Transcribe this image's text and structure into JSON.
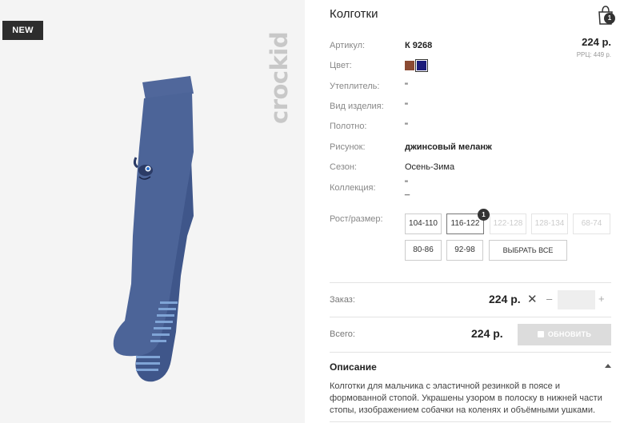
{
  "product": {
    "badge": "NEW",
    "brand": "crockid",
    "title": "Колготки",
    "cart_count": "1"
  },
  "attributes": [
    {
      "label": "Артикул:",
      "value": "К 9268"
    },
    {
      "label": "Цвет:",
      "value": ""
    },
    {
      "label": "Утеплитель:",
      "value": "\""
    },
    {
      "label": "Вид изделия:",
      "value": "\""
    },
    {
      "label": "Полотно:",
      "value": "\""
    },
    {
      "label": "Рисунок:",
      "value": "джинсовый меланж"
    },
    {
      "label": "Сезон:",
      "value": "Осень-Зима"
    },
    {
      "label": "Коллекция:",
      "value": "\"\n_"
    }
  ],
  "pricing": {
    "price": "224 р.",
    "rrp": "РРЦ: 449 р."
  },
  "colors": [
    "#8b4a33",
    "#1c1c7a"
  ],
  "sizes": {
    "label": "Рост/размер:",
    "options": [
      "104-110",
      "116-122",
      "122-128",
      "128-134",
      "68-74",
      "80-86",
      "92-98"
    ],
    "select_all": "ВЫБРАТЬ ВСЕ",
    "selected_count": "1"
  },
  "order": {
    "label": "Заказ:",
    "price": "224 р.",
    "times": "✕",
    "minus": "–",
    "plus": "+",
    "quantity": ""
  },
  "total": {
    "label": "Всего:",
    "price": "224 р.",
    "update_button": "ОБНОВИТЬ"
  },
  "description": {
    "heading": "Описание",
    "text": "Колготки для мальчика с эластичной резинкой в поясе и формованной стопой. Украшены узором в полоску в нижней части стопы, изображением собачки на коленях и объёмными ушками."
  }
}
